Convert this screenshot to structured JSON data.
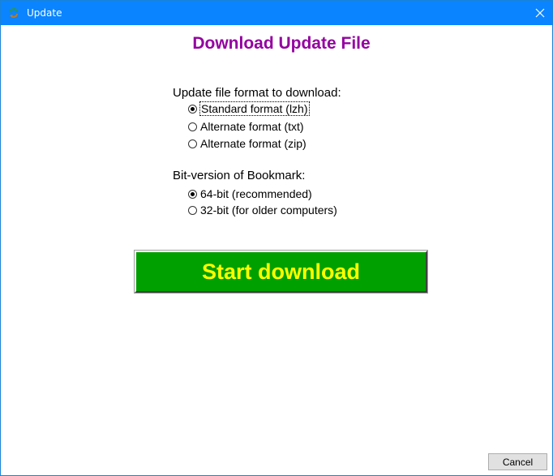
{
  "window": {
    "title": "Update",
    "accent_color": "#0a84ff",
    "icons": {
      "app": "refresh-arrows-icon",
      "close": "close-icon"
    }
  },
  "dialog": {
    "heading": "Download Update File",
    "heading_color": "#9400a0",
    "format_group": {
      "label": "Update file format to download:",
      "options": [
        {
          "label": "Standard format (lzh)",
          "selected": true
        },
        {
          "label": "Alternate format (txt)",
          "selected": false
        },
        {
          "label": "Alternate format (zip)",
          "selected": false
        }
      ]
    },
    "bit_group": {
      "label": "Bit-version of Bookmark:",
      "options": [
        {
          "label": "64-bit (recommended)",
          "selected": true
        },
        {
          "label": "32-bit (for older computers)",
          "selected": false
        }
      ]
    },
    "start_button": {
      "label": "Start download",
      "bg_color": "#00a000",
      "text_color": "#ffff00"
    },
    "cancel_button": {
      "label": "Cancel"
    }
  }
}
